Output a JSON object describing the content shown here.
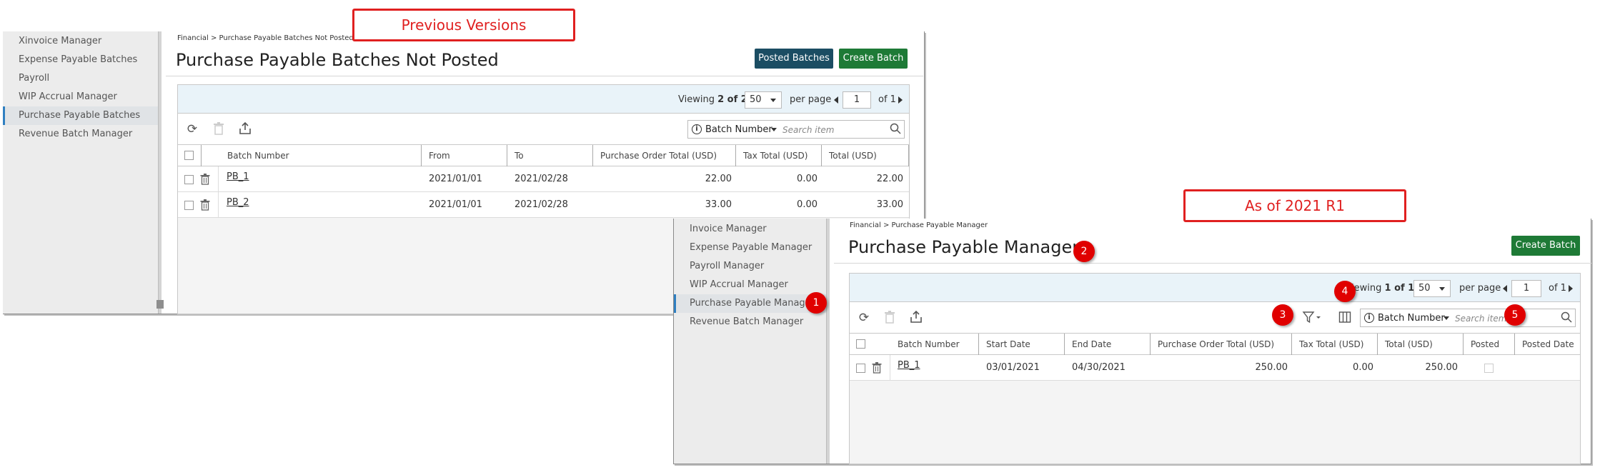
{
  "labels": {
    "previous": "Previous Versions",
    "current": "As of 2021 R1"
  },
  "badges": [
    "1",
    "2",
    "3",
    "4",
    "5"
  ],
  "old": {
    "sidebar": [
      "Xinvoice Manager",
      "Expense Payable Batches",
      "Payroll",
      "WIP Accrual Manager",
      "Purchase Payable Batches",
      "Revenue Batch Manager"
    ],
    "breadcrumb": "Financial > Purchase Payable Batches Not Posted",
    "title": "Purchase Payable Batches Not Posted",
    "buttons": {
      "posted": "Posted Batches",
      "create": "Create Batch"
    },
    "pager": {
      "viewing": "Viewing",
      "range": "2 of 2",
      "per_page_value": "50",
      "per_page": "per page",
      "page": "1",
      "of": "of 1"
    },
    "search": {
      "field": "Batch Number",
      "placeholder": "Search item"
    },
    "columns": [
      "Batch Number",
      "From",
      "To",
      "Purchase Order Total (USD)",
      "Tax Total (USD)",
      "Total (USD)"
    ],
    "rows": [
      {
        "batch": "PB_1",
        "from": "2021/01/01",
        "to": "2021/02/28",
        "po_total": "22.00",
        "tax": "0.00",
        "total": "22.00"
      },
      {
        "batch": "PB_2",
        "from": "2021/01/01",
        "to": "2021/02/28",
        "po_total": "33.00",
        "tax": "0.00",
        "total": "33.00"
      }
    ]
  },
  "new": {
    "sidebar": [
      "Invoice Manager",
      "Expense Payable Manager",
      "Payroll Manager",
      "WIP Accrual Manager",
      "Purchase Payable Manager",
      "Revenue Batch Manager"
    ],
    "breadcrumb": "Financial > Purchase Payable Manager",
    "title": "Purchase Payable Manager",
    "buttons": {
      "create": "Create Batch"
    },
    "pager": {
      "viewing": "iewing",
      "range": "1 of 1",
      "per_page_value": "50",
      "per_page": "per page",
      "page": "1",
      "of": "of 1"
    },
    "search": {
      "field": "Batch Number",
      "placeholder": "Search item"
    },
    "columns": [
      "Batch Number",
      "Start Date",
      "End Date",
      "Purchase Order Total (USD)",
      "Tax Total (USD)",
      "Total (USD)",
      "Posted",
      "Posted Date"
    ],
    "rows": [
      {
        "batch": "PB_1",
        "start": "03/01/2021",
        "end": "04/30/2021",
        "po_total": "250.00",
        "tax": "0.00",
        "total": "250.00",
        "posted_date": ""
      }
    ]
  }
}
